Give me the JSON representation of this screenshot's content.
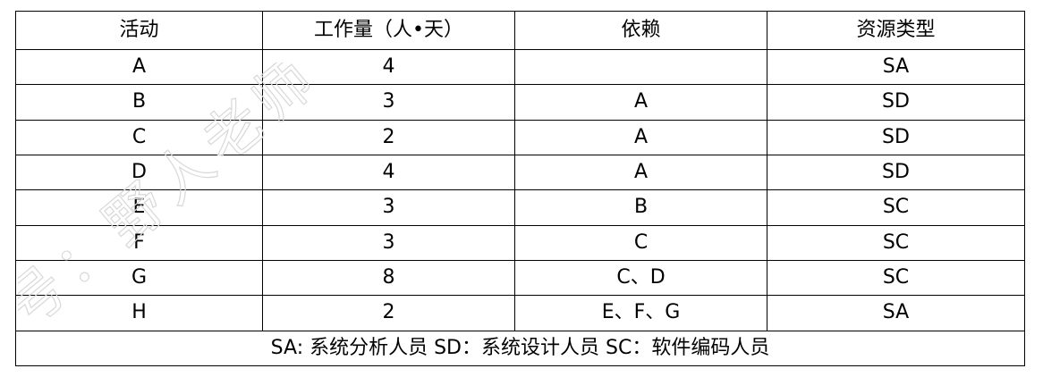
{
  "table": {
    "headers": [
      "活动",
      "工作量（人•天）",
      "依赖",
      "资源类型"
    ],
    "rows": [
      [
        "A",
        "4",
        "",
        "SA"
      ],
      [
        "B",
        "3",
        "A",
        "SD"
      ],
      [
        "C",
        "2",
        "A",
        "SD"
      ],
      [
        "D",
        "4",
        "A",
        "SD"
      ],
      [
        "E",
        "3",
        "B",
        "SC"
      ],
      [
        "F",
        "3",
        "C",
        "SC"
      ],
      [
        "G",
        "8",
        "C、D",
        "SC"
      ],
      [
        "H",
        "2",
        "E、F、G",
        "SA"
      ]
    ],
    "footnote": "SA: 系统分析人员  SD：系统设计人员  SC：软件编码人员"
  },
  "watermark": {
    "text": "号：野人老师",
    "color": "#d8d8d8"
  }
}
